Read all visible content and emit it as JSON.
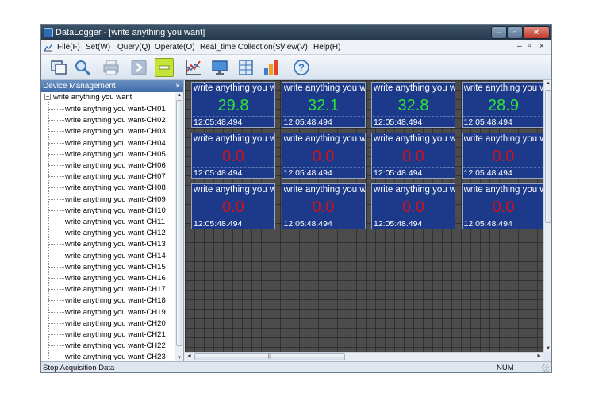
{
  "window": {
    "title": "DataLogger - [write anything you want]"
  },
  "menu": {
    "items": [
      "File(F)",
      "Set(W)",
      "Query(Q)",
      "Operate(O)",
      "Real_time Collection(S)",
      "View(V)",
      "Help(H)"
    ],
    "mdi_controls": [
      "–",
      "▫",
      "×"
    ]
  },
  "toolbar": {
    "buttons": [
      "window-icon",
      "search-icon",
      "print-icon",
      "next-icon",
      "minus-icon",
      "chart-icon",
      "monitor-icon",
      "table-icon",
      "bar-chart-icon",
      "help-icon"
    ],
    "colors": {
      "active_button": "#c6e33a"
    }
  },
  "sidebar": {
    "title": "Device Management",
    "close": "×",
    "root": "write anything you want",
    "items": [
      "write anything you want-CH01",
      "write anything you want-CH02",
      "write anything you want-CH03",
      "write anything you want-CH04",
      "write anything you want-CH05",
      "write anything you want-CH06",
      "write anything you want-CH07",
      "write anything you want-CH08",
      "write anything you want-CH09",
      "write anything you want-CH10",
      "write anything you want-CH11",
      "write anything you want-CH12",
      "write anything you want-CH13",
      "write anything you want-CH14",
      "write anything you want-CH15",
      "write anything you want-CH16",
      "write anything you want-CH17",
      "write anything you want-CH18",
      "write anything you want-CH19",
      "write anything you want-CH20",
      "write anything you want-CH21",
      "write anything you want-CH22",
      "write anything you want-CH23"
    ]
  },
  "tiles": [
    {
      "name": "write anything you want",
      "value": "29.8",
      "time": "12:05:48.494",
      "status": "ok"
    },
    {
      "name": "write anything you want",
      "value": "32.1",
      "time": "12:05:48.494",
      "status": "ok"
    },
    {
      "name": "write anything you want",
      "value": "32.8",
      "time": "12:05:48.494",
      "status": "ok"
    },
    {
      "name": "write anything you want",
      "value": "28.9",
      "time": "12:05:48.494",
      "status": "ok"
    },
    {
      "name": "write anything you want",
      "value": "0.0",
      "time": "12:05:48.494",
      "status": "bad"
    },
    {
      "name": "write anything you want",
      "value": "0.0",
      "time": "12:05:48.494",
      "status": "bad"
    },
    {
      "name": "write anything you want",
      "value": "0.0",
      "time": "12:05:48.494",
      "status": "bad"
    },
    {
      "name": "write anything you want",
      "value": "0.0",
      "time": "12:05:48.494",
      "status": "bad"
    },
    {
      "name": "write anything you want",
      "value": "0.0",
      "time": "12:05:48.494",
      "status": "bad"
    },
    {
      "name": "write anything you want",
      "value": "0.0",
      "time": "12:05:48.494",
      "status": "bad"
    },
    {
      "name": "write anything you want",
      "value": "0.0",
      "time": "12:05:48.494",
      "status": "bad"
    },
    {
      "name": "write anything you want",
      "value": "0.0",
      "time": "12:05:48.494",
      "status": "bad"
    }
  ],
  "colors": {
    "tile_bg": "#1d3a8a",
    "value_ok": "#28e43a",
    "value_bad": "#d0121c"
  },
  "statusbar": {
    "message": "Stop Acquisition Data",
    "num": "NUM"
  }
}
